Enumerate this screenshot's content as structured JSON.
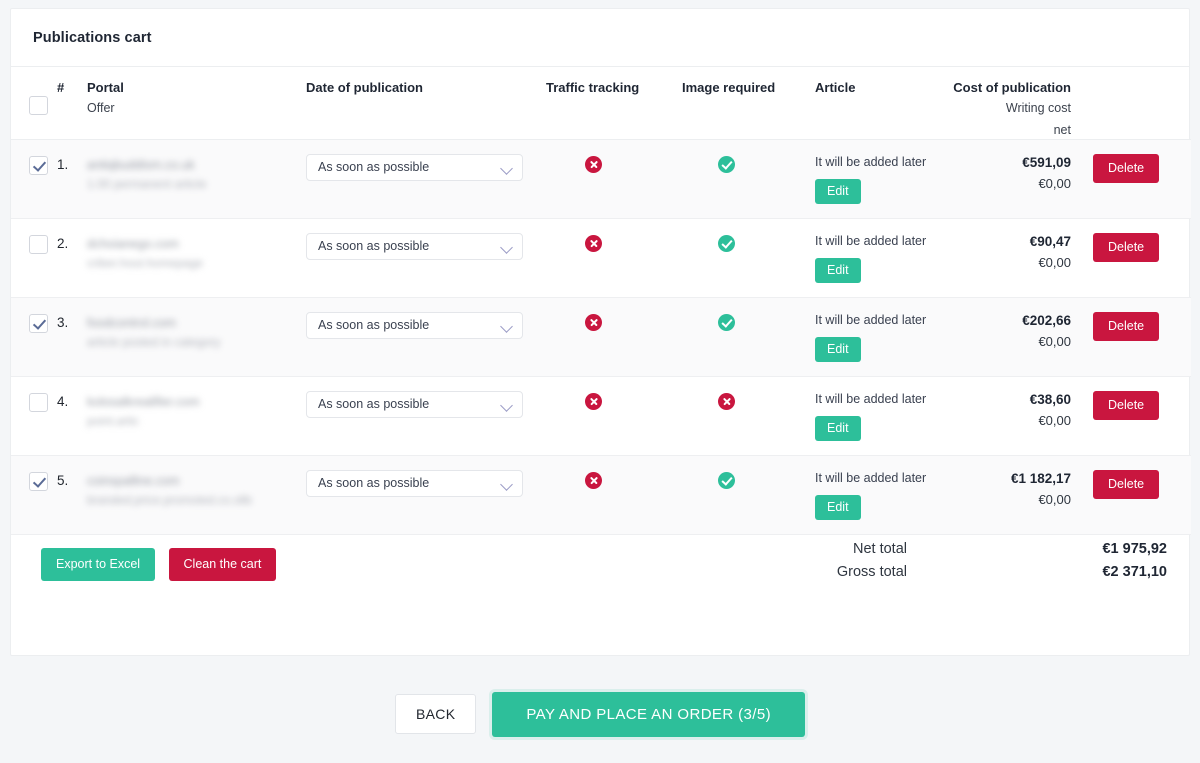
{
  "card": {
    "title": "Publications cart"
  },
  "table": {
    "headers": {
      "portal": "Portal",
      "portal_sub": "Offer",
      "date": "Date of publication",
      "traffic": "Traffic tracking",
      "image": "Image required",
      "article": "Article",
      "cost": "Cost of publication",
      "cost_sub1": "Writing cost",
      "cost_sub2": "net",
      "number": "#"
    },
    "rows": [
      {
        "num": "1.",
        "selected": true,
        "portal": "antiqbuddism.co.uk",
        "offer": "1.00 permanent article",
        "date_value": "As soon as possible",
        "traffic": "no",
        "image": "yes",
        "article_text": "It will be added later",
        "edit_label": "Edit",
        "cost": "€591,09",
        "writing_cost": "€0,00",
        "delete_label": "Delete"
      },
      {
        "num": "2.",
        "selected": false,
        "portal": "dchoianego.com",
        "offer": "criber.hout.homepage",
        "date_value": "As soon as possible",
        "traffic": "no",
        "image": "yes",
        "article_text": "It will be added later",
        "edit_label": "Edit",
        "cost": "€90,47",
        "writing_cost": "€0,00",
        "delete_label": "Delete"
      },
      {
        "num": "3.",
        "selected": true,
        "portal": "foodcontrol.com",
        "offer": "article posted in category",
        "date_value": "As soon as possible",
        "traffic": "no",
        "image": "yes",
        "article_text": "It will be added later",
        "edit_label": "Edit",
        "cost": "€202,66",
        "writing_cost": "€0,00",
        "delete_label": "Delete"
      },
      {
        "num": "4.",
        "selected": false,
        "portal": "kolosalkrealifier.com",
        "offer": "point.artic",
        "date_value": "As soon as possible",
        "traffic": "no",
        "image": "no",
        "article_text": "It will be added later",
        "edit_label": "Edit",
        "cost": "€38,60",
        "writing_cost": "€0,00",
        "delete_label": "Delete"
      },
      {
        "num": "5.",
        "selected": true,
        "portal": "coinspalline.com",
        "offer": "branded.price.promoted.co.sllb",
        "date_value": "As soon as possible",
        "traffic": "no",
        "image": "yes",
        "article_text": "It will be added later",
        "edit_label": "Edit",
        "cost": "€1 182,17",
        "writing_cost": "€0,00",
        "delete_label": "Delete"
      }
    ]
  },
  "actions": {
    "export_label": "Export to Excel",
    "clean_label": "Clean the cart"
  },
  "totals": {
    "net_label": "Net total",
    "net_value": "€1 975,92",
    "gross_label": "Gross total",
    "gross_value": "€2 371,10"
  },
  "footer": {
    "back_label": "BACK",
    "pay_label": "PAY AND PLACE AN ORDER (3/5)"
  },
  "colors": {
    "accent_green": "#2dbf9a",
    "accent_red": "#c9163f",
    "page_bg": "#f4f6f8"
  }
}
